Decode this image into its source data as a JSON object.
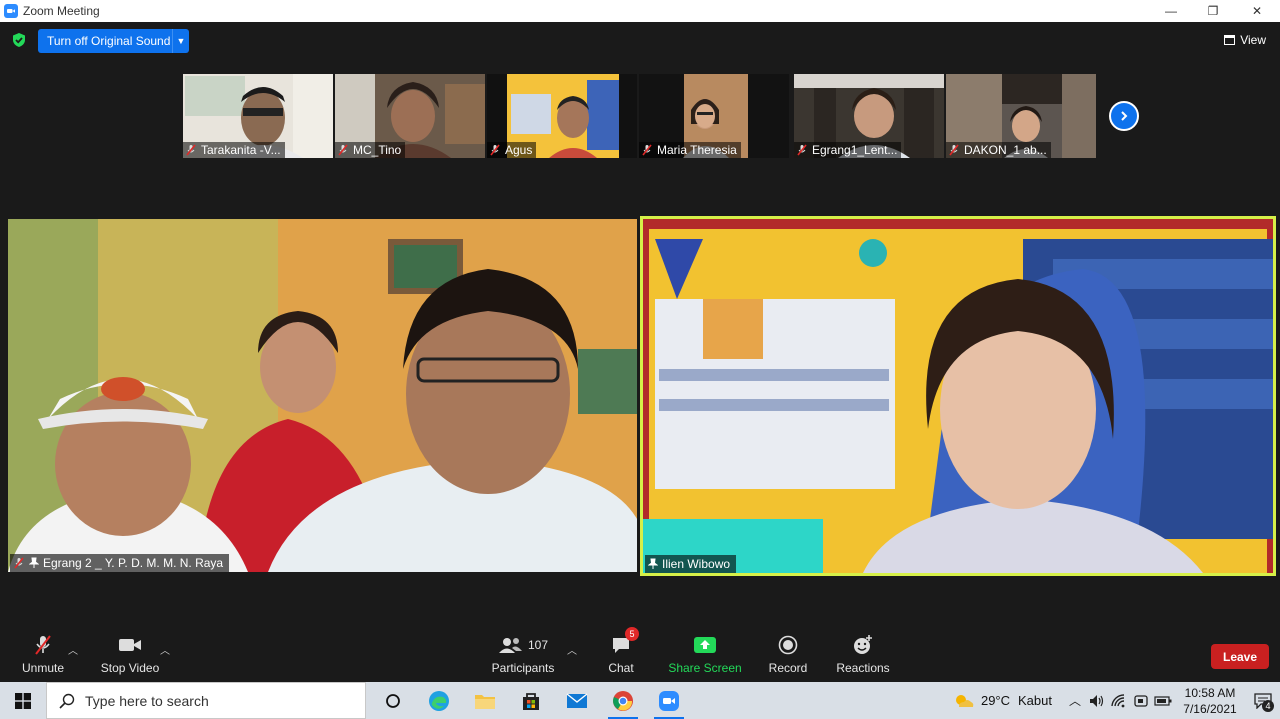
{
  "window": {
    "title": "Zoom Meeting",
    "minimize": "—",
    "restore": "❐",
    "close": "✕"
  },
  "header": {
    "original_sound_label": "Turn off Original Sound",
    "view_label": "View"
  },
  "thumbnails": [
    {
      "name": "Tarakanita -V..."
    },
    {
      "name": "MC_Tino"
    },
    {
      "name": "Agus"
    },
    {
      "name": "Maria Theresia"
    },
    {
      "name": "Egrang1_Lent..."
    },
    {
      "name": "DAKON_1 ab..."
    }
  ],
  "main_tiles": [
    {
      "name": "Egrang 2 _ Y. P. D. M. M. N. Raya"
    },
    {
      "name": "Ilien Wibowo"
    }
  ],
  "toolbar": {
    "unmute_label": "Unmute",
    "stop_video_label": "Stop Video",
    "participants_label": "Participants",
    "participants_count": "107",
    "chat_label": "Chat",
    "chat_badge": "5",
    "share_screen_label": "Share Screen",
    "record_label": "Record",
    "reactions_label": "Reactions",
    "leave_label": "Leave"
  },
  "taskbar": {
    "search_placeholder": "Type here to search",
    "weather_temp": "29°C",
    "weather_desc": "Kabut",
    "time": "10:58 AM",
    "date": "7/16/2021",
    "notification_count": "4"
  },
  "colors": {
    "accent": "#0e72ed",
    "share_green": "#23d959",
    "leave_red": "#c92020",
    "active_speaker_border": "#d6f048"
  }
}
